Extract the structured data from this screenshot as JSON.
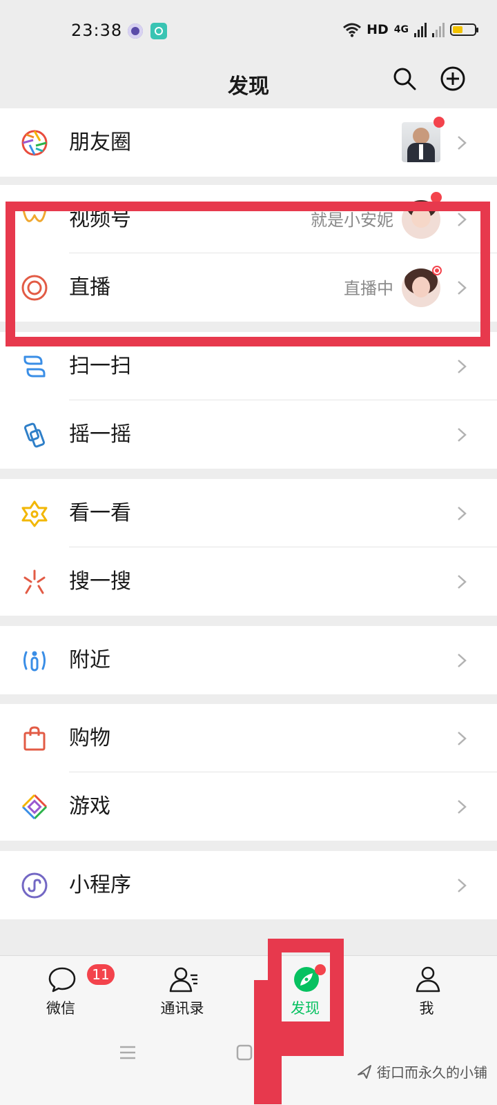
{
  "status": {
    "time": "23:38",
    "network": "HD",
    "gen": "4G",
    "colors": {
      "battery": "#f2c200"
    }
  },
  "header": {
    "title": "发现",
    "icons": [
      "search-icon",
      "add-circle-icon"
    ]
  },
  "groups": {
    "moments": {
      "label": "朋友圈",
      "icon": "moments-shutter-icon"
    },
    "channels": {
      "label": "视频号",
      "subtitle": "就是小安妮",
      "icon": "channels-icon"
    },
    "live": {
      "label": "直播",
      "subtitle": "直播中",
      "icon": "live-ring-icon"
    },
    "scan": {
      "label": "扫一扫",
      "icon": "scan-icon"
    },
    "shake": {
      "label": "摇一摇",
      "icon": "shake-icon"
    },
    "top_stories": {
      "label": "看一看",
      "icon": "top-stories-icon"
    },
    "search": {
      "label": "搜一搜",
      "icon": "search-spark-icon"
    },
    "nearby": {
      "label": "附近",
      "icon": "nearby-people-icon"
    },
    "shopping": {
      "label": "购物",
      "icon": "shopping-bag-icon"
    },
    "games": {
      "label": "游戏",
      "icon": "games-icon"
    },
    "mini_programs": {
      "label": "小程序",
      "icon": "mini-programs-icon"
    }
  },
  "tabs": {
    "chats": {
      "label": "微信",
      "badge": "11"
    },
    "contacts": {
      "label": "通讯录"
    },
    "discover": {
      "label": "发现"
    },
    "me": {
      "label": "我"
    }
  },
  "watermark": "街口而永久的小铺",
  "colors": {
    "accent": "#07c160",
    "badge": "#f3434c",
    "annotation": "#e7394d"
  }
}
